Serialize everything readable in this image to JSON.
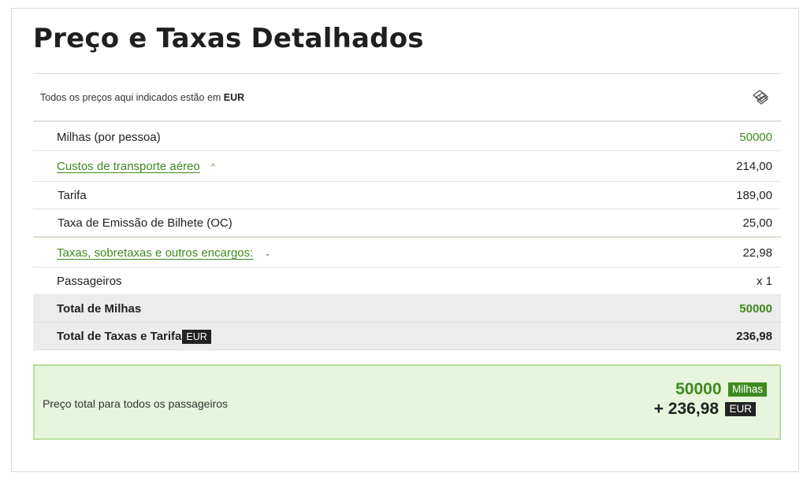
{
  "page": {
    "title": "Preço e Taxas Detalhados"
  },
  "currency": {
    "prefix": "Todos os preços aqui indicados estão em",
    "code": "EUR",
    "icon": "currency-exchange-icon"
  },
  "rows": {
    "miles": {
      "label": "Milhas (por pessoa)",
      "value": "50000"
    },
    "air_costs": {
      "label": "Custos de transporte aéreo",
      "value": "214,00",
      "chevron": "^"
    },
    "fare": {
      "label": "Tarifa",
      "value": "189,00"
    },
    "ticket_fee": {
      "label": "Taxa de Emissão de Bilhete (OC)",
      "value": "25,00"
    },
    "taxes": {
      "label": "Taxas, sobretaxas e outros encargos:",
      "value": "22,98",
      "chevron": "v"
    },
    "passengers": {
      "label": "Passageiros",
      "value": "x 1"
    },
    "total_miles": {
      "label": "Total de Milhas",
      "value": "50000"
    },
    "total_taxes": {
      "label": "Total de Taxas e Tarifa",
      "badge": "EUR",
      "value": "236,98"
    }
  },
  "summary": {
    "label": "Preço total para todos os passageiros",
    "miles_value": "50000",
    "miles_badge": "Milhas",
    "eur_value": "+ 236,98",
    "eur_badge": "EUR"
  },
  "colors": {
    "accent_green": "#3f8a1f",
    "summary_bg": "#e6f5dc",
    "total_bg": "#ececec",
    "badge_dark": "#222222"
  }
}
